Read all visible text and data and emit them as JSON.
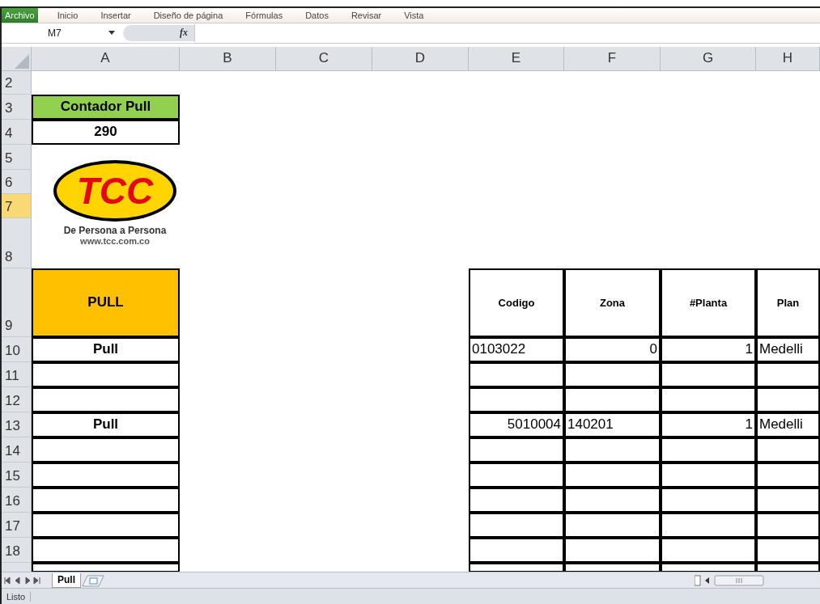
{
  "ribbon_tabs": [
    {
      "label": "Archivo",
      "selected": true
    },
    {
      "label": "Inicio",
      "selected": false
    },
    {
      "label": "Insertar",
      "selected": false
    },
    {
      "label": "Diseño de página",
      "selected": false
    },
    {
      "label": "Fórmulas",
      "selected": false
    },
    {
      "label": "Datos",
      "selected": false
    },
    {
      "label": "Revisar",
      "selected": false
    },
    {
      "label": "Vista",
      "selected": false
    }
  ],
  "formula_bar": {
    "name_box": "M7",
    "fx": "fx"
  },
  "columns": [
    "A",
    "B",
    "C",
    "D",
    "E",
    "F",
    "G",
    "H"
  ],
  "logo": {
    "mark": "TCC",
    "tagline": "De Persona a Persona",
    "url": "www.tcc.com.co"
  },
  "rows": [
    {
      "number": "2",
      "selected": false
    },
    {
      "number": "3",
      "selected": false,
      "cells": [
        {
          "kind": "title",
          "text": "Contador Pull",
          "color": "#92d050"
        }
      ]
    },
    {
      "number": "4",
      "selected": false,
      "cells": [
        {
          "kind": "bold",
          "text": "290"
        }
      ]
    },
    {
      "number": "5",
      "selected": false
    },
    {
      "number": "6",
      "selected": false
    },
    {
      "number": "7",
      "selected": true
    },
    {
      "number": "8",
      "selected": false
    },
    {
      "number": "9",
      "selected": false,
      "cells": [
        {
          "kind": "title",
          "text": "PULL",
          "color": "#ffc000"
        },
        {
          "kind": "blank"
        },
        {
          "kind": "blank"
        },
        {
          "kind": "blank"
        },
        {
          "kind": "heading",
          "text": "Codigo"
        },
        {
          "kind": "heading",
          "text": "Zona"
        },
        {
          "kind": "heading",
          "text": "#Planta"
        },
        {
          "kind": "heading",
          "text": "Plan"
        }
      ]
    },
    {
      "number": "10",
      "selected": false,
      "cells": [
        {
          "kind": "bold",
          "text": "Pull"
        },
        {
          "kind": "blank"
        },
        {
          "kind": "blank"
        },
        {
          "kind": "blank"
        },
        {
          "kind": "text",
          "text": "0103022"
        },
        {
          "kind": "number",
          "text": "0"
        },
        {
          "kind": "number",
          "text": "1"
        },
        {
          "kind": "text",
          "text": "Medelli"
        }
      ]
    },
    {
      "number": "11",
      "selected": false,
      "cells": [
        {
          "kind": "boxed"
        },
        {
          "kind": "blank"
        },
        {
          "kind": "blank"
        },
        {
          "kind": "blank"
        },
        {
          "kind": "boxed"
        },
        {
          "kind": "boxed"
        },
        {
          "kind": "boxed"
        },
        {
          "kind": "boxed"
        }
      ]
    },
    {
      "number": "12",
      "selected": false,
      "cells": [
        {
          "kind": "boxed"
        },
        {
          "kind": "blank"
        },
        {
          "kind": "blank"
        },
        {
          "kind": "blank"
        },
        {
          "kind": "boxed"
        },
        {
          "kind": "boxed"
        },
        {
          "kind": "boxed"
        },
        {
          "kind": "boxed"
        }
      ]
    },
    {
      "number": "13",
      "selected": false,
      "cells": [
        {
          "kind": "bold",
          "text": "Pull"
        },
        {
          "kind": "blank"
        },
        {
          "kind": "blank"
        },
        {
          "kind": "blank"
        },
        {
          "kind": "number",
          "text": "5010004"
        },
        {
          "kind": "text",
          "text": "140201"
        },
        {
          "kind": "number",
          "text": "1"
        },
        {
          "kind": "text",
          "text": "Medelli"
        }
      ]
    },
    {
      "number": "14",
      "selected": false,
      "cells": [
        {
          "kind": "boxed"
        },
        {
          "kind": "blank"
        },
        {
          "kind": "blank"
        },
        {
          "kind": "blank"
        },
        {
          "kind": "boxed"
        },
        {
          "kind": "boxed"
        },
        {
          "kind": "boxed"
        },
        {
          "kind": "boxed"
        }
      ]
    },
    {
      "number": "15",
      "selected": false,
      "cells": [
        {
          "kind": "boxed"
        },
        {
          "kind": "blank"
        },
        {
          "kind": "blank"
        },
        {
          "kind": "blank"
        },
        {
          "kind": "boxed"
        },
        {
          "kind": "boxed"
        },
        {
          "kind": "boxed"
        },
        {
          "kind": "boxed"
        }
      ]
    },
    {
      "number": "16",
      "selected": false,
      "cells": [
        {
          "kind": "boxed"
        },
        {
          "kind": "blank"
        },
        {
          "kind": "blank"
        },
        {
          "kind": "blank"
        },
        {
          "kind": "boxed"
        },
        {
          "kind": "boxed"
        },
        {
          "kind": "boxed"
        },
        {
          "kind": "boxed"
        }
      ]
    },
    {
      "number": "17",
      "selected": false,
      "cells": [
        {
          "kind": "boxed"
        },
        {
          "kind": "blank"
        },
        {
          "kind": "blank"
        },
        {
          "kind": "blank"
        },
        {
          "kind": "boxed"
        },
        {
          "kind": "boxed"
        },
        {
          "kind": "boxed"
        },
        {
          "kind": "boxed"
        }
      ]
    },
    {
      "number": "18",
      "selected": false,
      "cells": [
        {
          "kind": "boxed"
        },
        {
          "kind": "blank"
        },
        {
          "kind": "blank"
        },
        {
          "kind": "blank"
        },
        {
          "kind": "boxed"
        },
        {
          "kind": "boxed"
        },
        {
          "kind": "boxed"
        },
        {
          "kind": "boxed"
        }
      ]
    },
    {
      "selected": false,
      "cells": [
        {
          "kind": "boxed"
        },
        {
          "kind": "blank"
        },
        {
          "kind": "blank"
        },
        {
          "kind": "blank"
        },
        {
          "kind": "boxed"
        },
        {
          "kind": "boxed"
        },
        {
          "kind": "boxed"
        },
        {
          "kind": "boxed"
        }
      ]
    }
  ],
  "sheet_tabs": [
    {
      "label": "Pull",
      "selected": true
    }
  ],
  "status_bar": {
    "text": "Listo"
  }
}
